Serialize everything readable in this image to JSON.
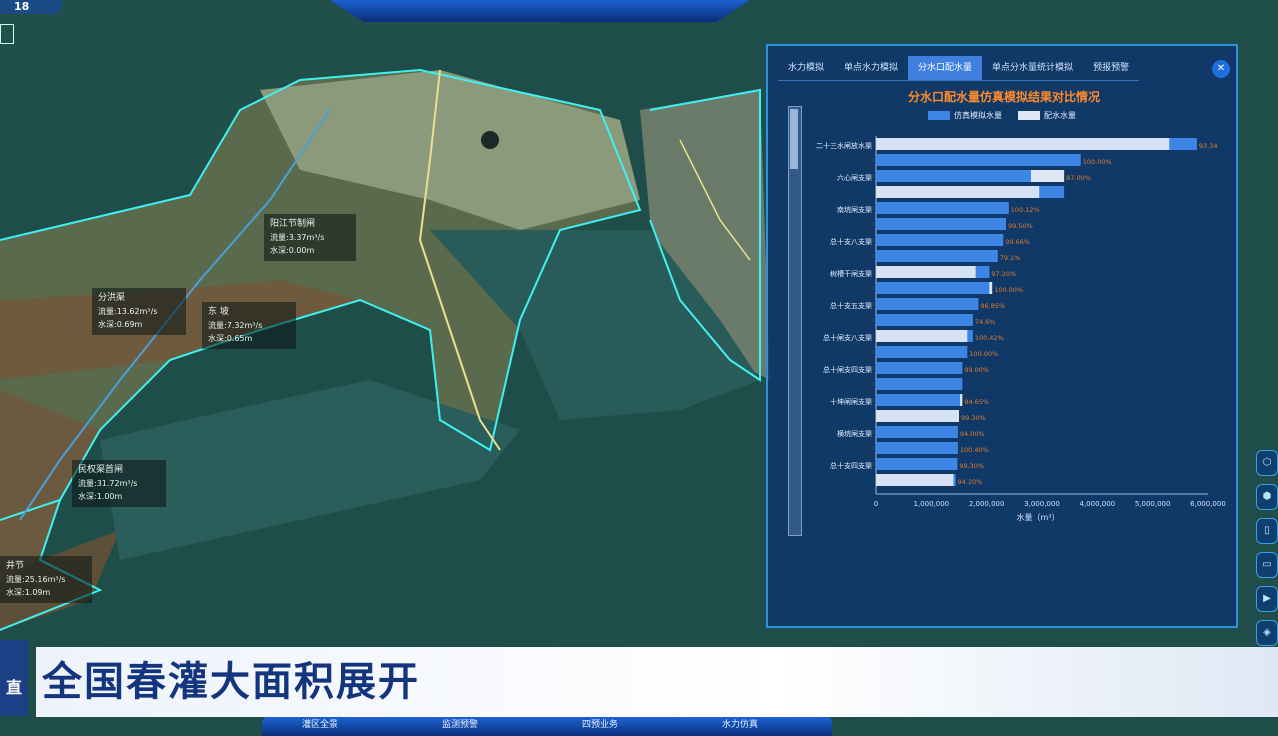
{
  "header": {
    "logo_text": "18"
  },
  "map": {
    "labels": [
      {
        "name": "阳江节制闸",
        "flow": "流量:3.37m³/s",
        "level": "水深:0.00m"
      },
      {
        "name": "分洪渠",
        "flow": "流量:13.62m³/s",
        "level": "水深:0.69m"
      },
      {
        "name": "东 坡",
        "flow": "流量:7.32m³/s",
        "level": "水深:0.65m"
      },
      {
        "name": "民权渠首闸",
        "flow": "流量:31.72m³/s",
        "level": "水深:1.00m"
      },
      {
        "name": "井节",
        "flow": "流量:25.16m³/s",
        "level": "水深:1.09m"
      }
    ]
  },
  "panel": {
    "tabs": [
      "水力模拟",
      "单点水力模拟",
      "分水口配水量",
      "单点分水量统计模拟",
      "预报预警"
    ],
    "active_tab": 2,
    "close_icon": "close-icon"
  },
  "chart_data": {
    "type": "bar",
    "orientation": "horizontal",
    "title": "分水口配水量仿真模拟结果对比情况",
    "xlabel": "水量（m³）",
    "xlim": [
      0,
      6000000
    ],
    "x_ticks": [
      "0",
      "1,000,000",
      "2,000,000",
      "3,000,000",
      "4,000,000",
      "5,000,000",
      "6,000,000"
    ],
    "categories_visible": [
      "二十三水闸放水渠",
      "六心闸支渠",
      "南垸闸支渠",
      "总十支八支渠",
      "树槽干闸支渠",
      "总十支五支渠",
      "总十闸支八支渠",
      "总十闸支四支渠",
      "十坤闸闸支渠",
      "横垸闸支渠",
      "总十支四支渠"
    ],
    "series": [
      {
        "name": "仿真模拟水量",
        "color": "#3d86e6",
        "values": [
          5800000,
          3700000,
          2800000,
          3400000,
          2400000,
          2350000,
          2300000,
          2200000,
          2050000,
          2050000,
          1850000,
          1750000,
          1750000,
          1650000,
          1560000,
          1560000,
          1520000,
          1500000,
          1480000,
          1480000,
          1470000,
          1440000
        ]
      },
      {
        "name": "配水水量",
        "color": "#dfe8f5",
        "values": [
          5300000,
          0,
          3400000,
          2950000,
          0,
          0,
          0,
          0,
          1800000,
          2100000,
          0,
          0,
          1650000,
          0,
          0,
          0,
          1560000,
          1500000,
          0,
          0,
          0,
          1400000
        ]
      }
    ],
    "data_labels": [
      "93.34",
      "100.00%",
      "87.00%",
      "",
      "100.12%",
      "99.50%",
      "99.66%",
      "79.1%",
      "97.20%",
      "100.00%",
      "96.85%",
      "74.6%",
      "100.42%",
      "100.00%",
      "99.00%",
      "",
      "94.65%",
      "99.30%",
      "94.00%",
      "100.40%",
      "99.30%",
      "94.20%"
    ]
  },
  "side_buttons": [
    "⬡",
    "⬢",
    "▯",
    "▭",
    "▶",
    "◈",
    "▯"
  ],
  "banner": {
    "text": "全国春灌大面积展开",
    "left_text": "直"
  },
  "bottom_nav": [
    "灌区全景",
    "监测预警",
    "四预业务",
    "水力仿真"
  ]
}
